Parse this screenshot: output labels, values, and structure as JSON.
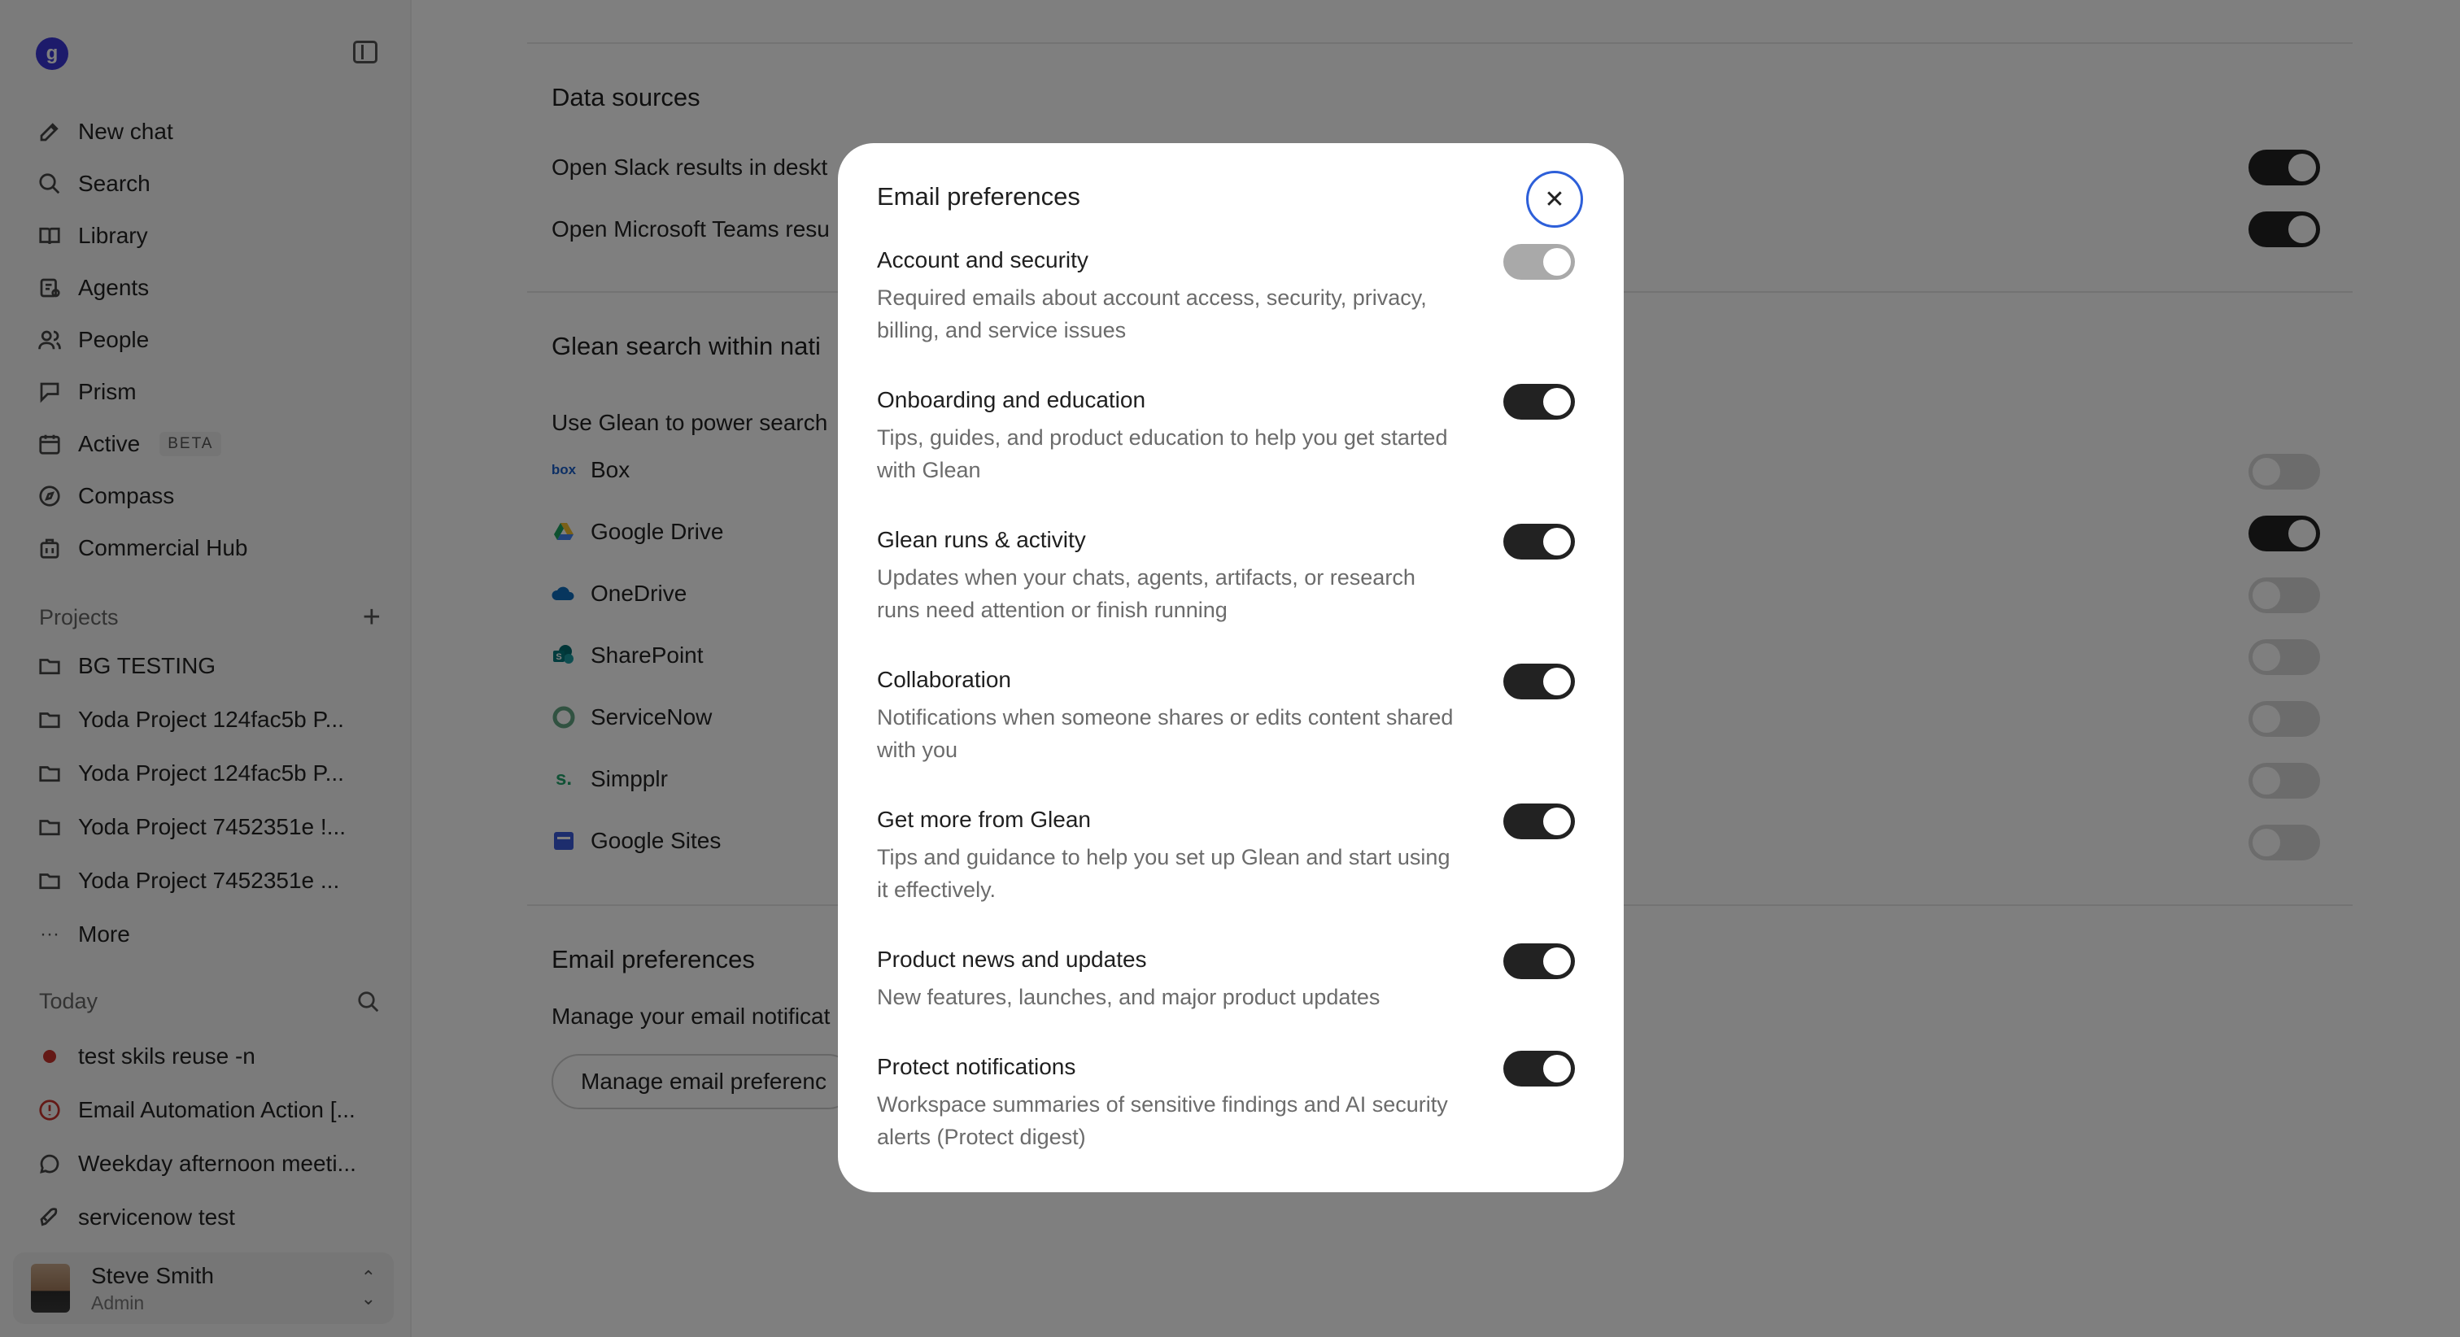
{
  "sidebar": {
    "logo_glyph": "g",
    "nav": [
      {
        "label": "New chat",
        "icon": "edit-icon"
      },
      {
        "label": "Search",
        "icon": "search-icon"
      },
      {
        "label": "Library",
        "icon": "book-icon"
      },
      {
        "label": "Agents",
        "icon": "agents-icon"
      },
      {
        "label": "People",
        "icon": "people-icon"
      },
      {
        "label": "Prism",
        "icon": "prism-icon"
      },
      {
        "label": "Active",
        "icon": "calendar-icon",
        "badge": "BETA"
      },
      {
        "label": "Compass",
        "icon": "compass-icon"
      },
      {
        "label": "Commercial Hub",
        "icon": "building-icon"
      }
    ],
    "projects": {
      "heading": "Projects",
      "items": [
        "BG TESTING",
        "Yoda Project 124fac5b P...",
        "Yoda Project 124fac5b P...",
        "Yoda Project 7452351e !...",
        "Yoda Project 7452351e ..."
      ],
      "more_label": "More"
    },
    "today": {
      "heading": "Today",
      "items": [
        {
          "label": "test skils reuse -n",
          "icon": "red-dot-icon"
        },
        {
          "label": "Email Automation Action [...",
          "icon": "alert-circle-icon"
        },
        {
          "label": "Weekday afternoon meeti...",
          "icon": "chat-bubble-icon"
        },
        {
          "label": "servicenow test",
          "icon": "rocket-icon"
        }
      ]
    },
    "user": {
      "name": "Steve Smith",
      "role": "Admin"
    }
  },
  "main": {
    "data_sources": {
      "title": "Data sources",
      "rows": [
        {
          "label": "Open Slack results in deskt",
          "on": true
        },
        {
          "label": "Open Microsoft Teams resu",
          "on": true
        }
      ]
    },
    "native_search": {
      "title": "Glean search within nati",
      "subtitle": "Use Glean to power search",
      "sources": [
        {
          "label": "Box",
          "logo": "box",
          "on": false
        },
        {
          "label": "Google Drive",
          "logo": "google-drive",
          "on": true
        },
        {
          "label": "OneDrive",
          "logo": "onedrive",
          "on": false
        },
        {
          "label": "SharePoint",
          "logo": "sharepoint",
          "on": false
        },
        {
          "label": "ServiceNow",
          "logo": "servicenow",
          "on": false
        },
        {
          "label": "Simpplr",
          "logo": "simpplr",
          "on": false
        },
        {
          "label": "Google Sites",
          "logo": "google-sites",
          "on": false
        }
      ]
    },
    "email_section": {
      "title": "Email preferences",
      "subtitle": "Manage your email notificat",
      "button": "Manage email preferenc"
    }
  },
  "modal": {
    "title": "Email preferences",
    "close_glyph": "✕",
    "items": [
      {
        "title": "Account and security",
        "desc": "Required emails about account access, security, privacy, billing, and service issues",
        "on": true,
        "locked": true
      },
      {
        "title": "Onboarding and education",
        "desc": "Tips, guides, and product education to help you get started with Glean",
        "on": true
      },
      {
        "title": "Glean runs & activity",
        "desc": "Updates when your chats, agents, artifacts, or research runs need attention or finish running",
        "on": true
      },
      {
        "title": "Collaboration",
        "desc": "Notifications when someone shares or edits content shared with you",
        "on": true
      },
      {
        "title": "Get more from Glean",
        "desc": "Tips and guidance to help you set up Glean and start using it effectively.",
        "on": true
      },
      {
        "title": "Product news and updates",
        "desc": "New features, launches, and major product updates",
        "on": true
      },
      {
        "title": "Protect notifications",
        "desc": "Workspace summaries of sensitive findings and AI security alerts (Protect digest)",
        "on": true
      }
    ]
  }
}
